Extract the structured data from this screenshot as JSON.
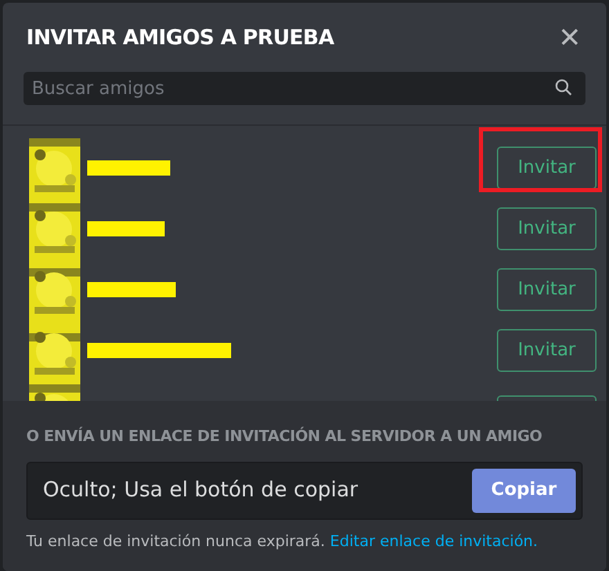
{
  "dialog": {
    "title": "INVITAR AMIGOS A PRUEBA",
    "close": "✕"
  },
  "search": {
    "placeholder": "Buscar amigos"
  },
  "friends": [
    {
      "kind": "full",
      "button": "Invitar",
      "highlighted": true
    },
    {
      "kind": "full",
      "button": "Invitar",
      "highlighted": false
    },
    {
      "kind": "full",
      "button": "Invitar",
      "highlighted": false
    },
    {
      "kind": "full",
      "button": "Invitar",
      "highlighted": false
    },
    {
      "kind": "partial"
    }
  ],
  "invite_link": {
    "heading": "O ENVÍA UN ENLACE DE INVITACIÓN AL SERVIDOR A UN AMIGO",
    "value": "Oculto; Usa el botón de copiar",
    "button": "Copiar",
    "note": "Tu enlace de invitación nunca expirará.",
    "link": "Editar enlace de invitación."
  }
}
